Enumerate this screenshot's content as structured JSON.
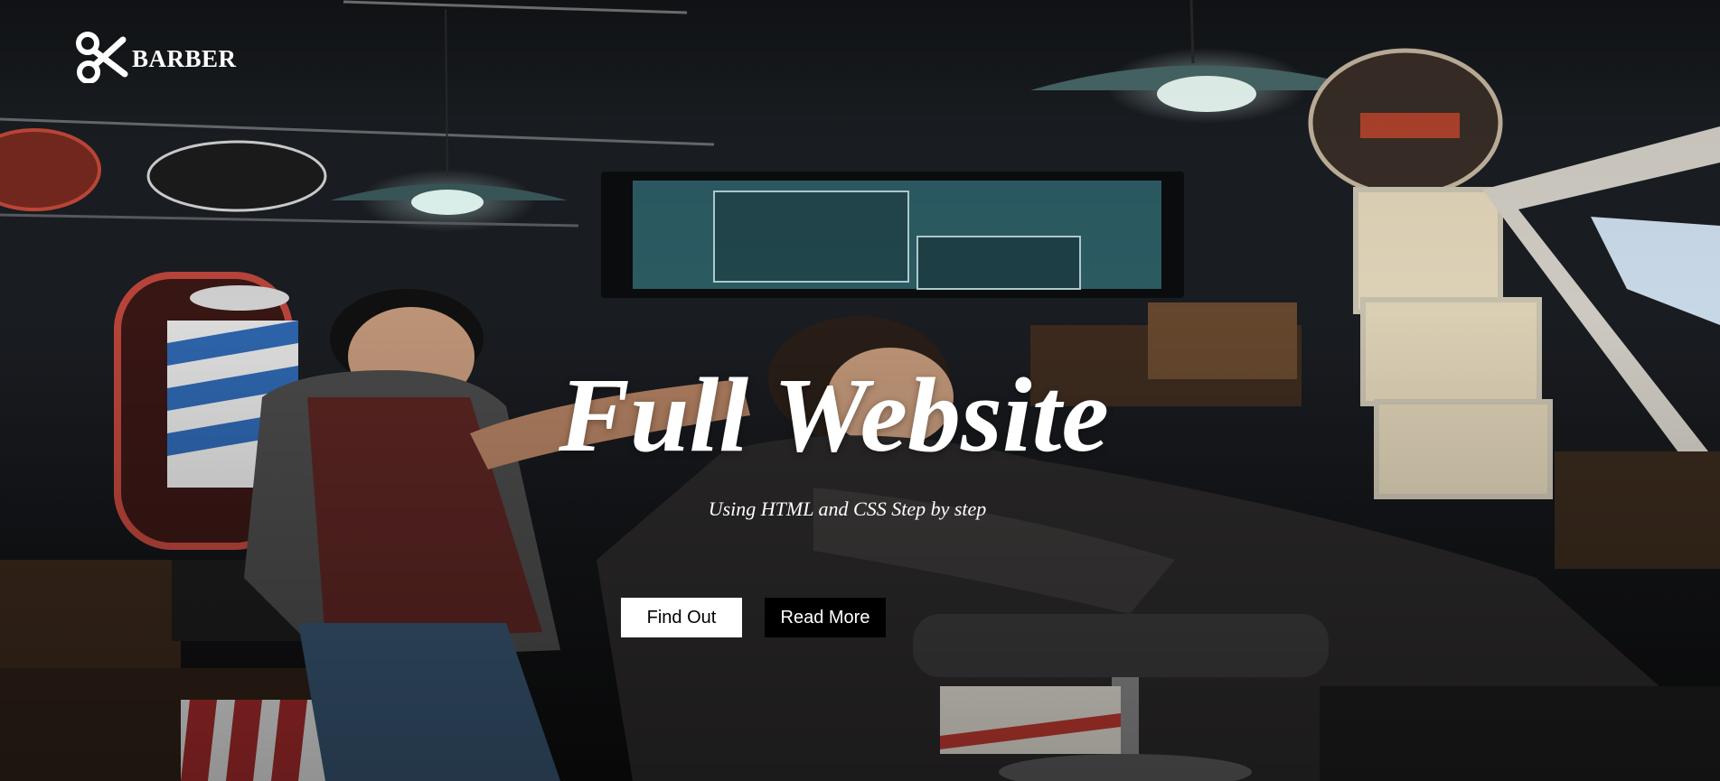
{
  "header": {
    "brand_name": "BARBER",
    "logo_icon": "scissors-icon"
  },
  "hero": {
    "title": "Full Website",
    "subtitle": "Using HTML and CSS Step by step",
    "buttons": [
      {
        "label": "Find Out",
        "style": "light"
      },
      {
        "label": "Read More",
        "style": "dark"
      }
    ]
  },
  "colors": {
    "text": "#ffffff",
    "button_light_bg": "#ffffff",
    "button_dark_bg": "#000000",
    "overlay": "#15171b"
  }
}
